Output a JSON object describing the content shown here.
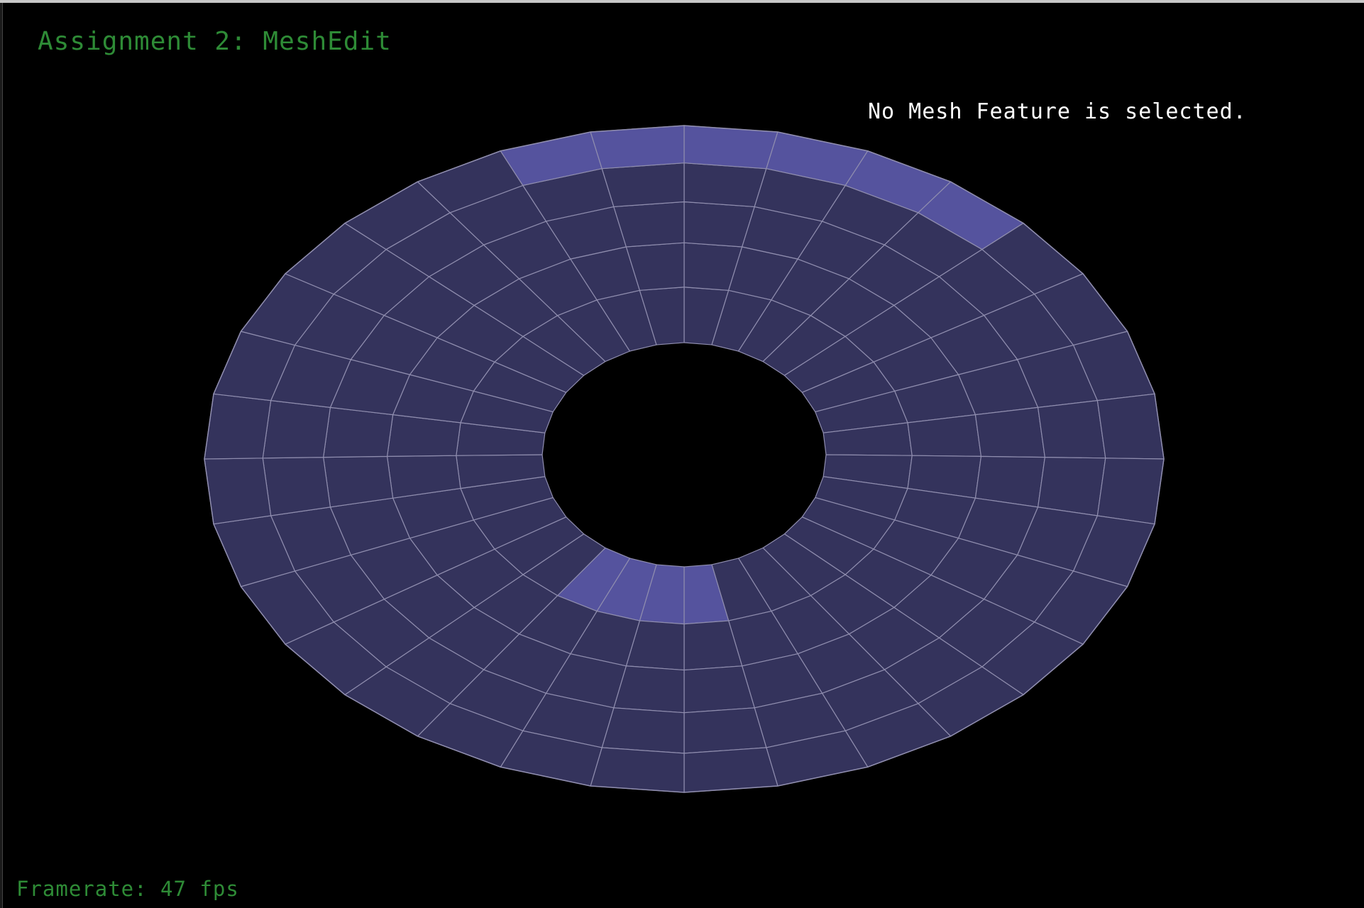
{
  "app": {
    "title": "Assignment 2: MeshEdit"
  },
  "status": {
    "selection": "No Mesh Feature is selected."
  },
  "footer": {
    "framerate": "Framerate: 47 fps"
  },
  "viewport": {
    "background_color": "#000000",
    "mesh_shape": "torus",
    "mesh_face_color": "#34335c",
    "mesh_backface_color": "#55539e",
    "mesh_edge_color": "#8f8dae",
    "text_color_green": "#2e8b36",
    "text_color_white": "#ffffff"
  }
}
